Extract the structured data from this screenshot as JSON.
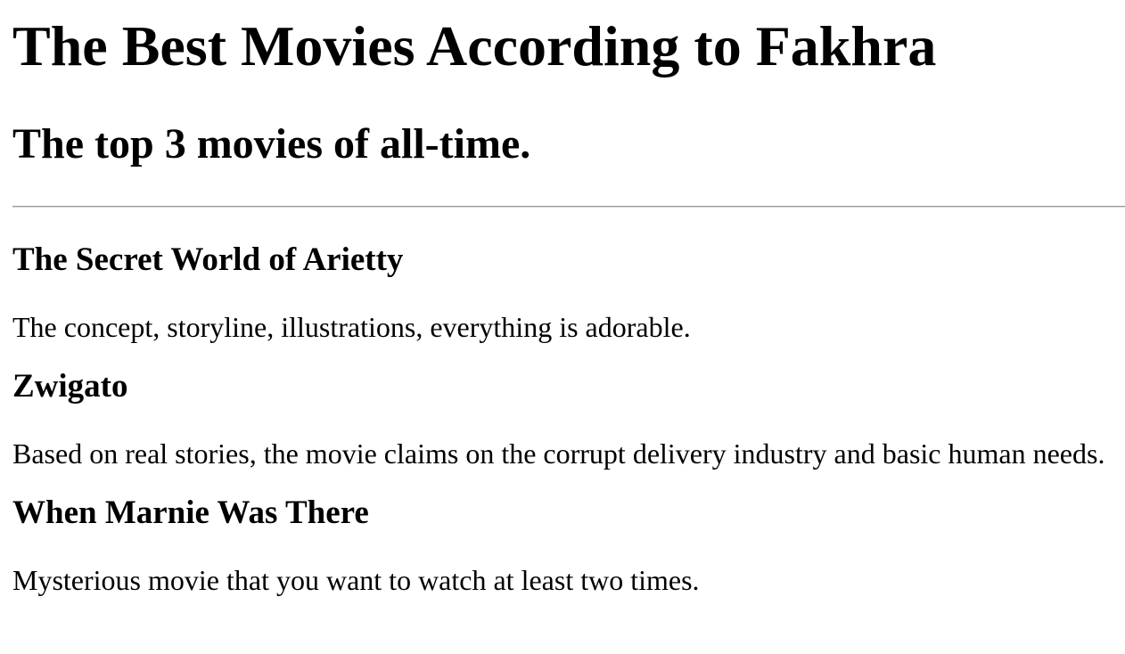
{
  "page": {
    "title": "The Best Movies According to Fakhra",
    "subtitle": "The top 3 movies of all-time."
  },
  "movies": [
    {
      "title": "The Secret World of Arietty",
      "description": "The concept, storyline, illustrations, everything is adorable."
    },
    {
      "title": "Zwigato",
      "description": "Based on real stories, the movie claims on the corrupt delivery industry and basic human needs."
    },
    {
      "title": "When Marnie Was There",
      "description": "Mysterious movie that you want to watch at least two times."
    }
  ]
}
